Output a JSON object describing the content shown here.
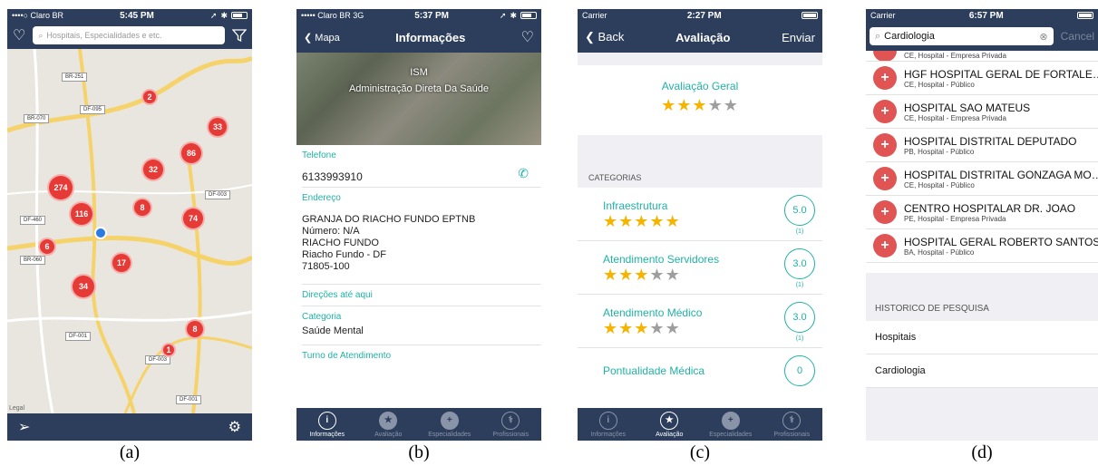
{
  "captions": [
    "(a)",
    "(b)",
    "(c)",
    "(d)"
  ],
  "colors": {
    "navy": "#2c3e5c",
    "teal": "#20b2a6",
    "red": "#e53a35",
    "star": "#f5b400"
  },
  "panel_a": {
    "status": {
      "carrier": "••••○ Claro BR",
      "time": "5:45 PM"
    },
    "search_placeholder": "Hospitais, Especialidades e etc.",
    "roads": [
      "BR-251",
      "BR-070",
      "DF-095",
      "DF-003",
      "DF-460",
      "BR-060",
      "DF-001",
      "DF-003",
      "DF-001"
    ],
    "clusters": [
      "2",
      "33",
      "86",
      "32",
      "274",
      "116",
      "8",
      "74",
      "6",
      "17",
      "34",
      "8",
      "1"
    ],
    "legal": "Legal"
  },
  "panel_b": {
    "status": {
      "carrier": "••••• Claro BR  3G",
      "time": "5:37 PM"
    },
    "back_label": "Mapa",
    "title": "Informações",
    "photo_title": "ISM",
    "photo_subtitle": "Administração Direta Da Saúde",
    "phone_label": "Telefone",
    "phone_value": "6133993910",
    "address_label": "Endereço",
    "address_lines": [
      "GRANJA DO RIACHO FUNDO EPTNB",
      "Número: N/A",
      "RIACHO FUNDO",
      "Riacho Fundo - DF",
      "71805-100"
    ],
    "directions_label": "Direções até aqui",
    "category_label": "Categoria",
    "category_value": "Saúde Mental",
    "hours_label": "Turno  de Atendimento",
    "tabs": [
      "Informações",
      "Avaliação",
      "Especialidades",
      "Profissionais"
    ]
  },
  "panel_c": {
    "status": {
      "carrier": "Carrier",
      "time": "2:27 PM"
    },
    "back_label": "Back",
    "title": "Avaliação",
    "send_label": "Enviar",
    "overall_label": "Avaliação Geral",
    "overall_stars": 3,
    "categories_header": "CATEGORIAS",
    "categories": [
      {
        "name": "Infraestrutura",
        "stars": 5,
        "score": "5.0",
        "count": "(1)"
      },
      {
        "name": "Atendimento Servidores",
        "stars": 3,
        "score": "3.0",
        "count": "(1)"
      },
      {
        "name": "Atendimento Médico",
        "stars": 3,
        "score": "3.0",
        "count": "(1)"
      },
      {
        "name": "Pontualidade Médica",
        "stars": 0,
        "score": "0",
        "count": ""
      }
    ],
    "tabs": [
      "Informações",
      "Avaliação",
      "Especialidades",
      "Profissionais"
    ]
  },
  "panel_d": {
    "status": {
      "carrier": "Carrier",
      "time": "6:57 PM"
    },
    "search_value": "Cardiologia",
    "cancel_label": "Cancel",
    "top_partial_sub": "CE, Hospital - Empresa Privada",
    "hospitals": [
      {
        "name": "HGF HOSPITAL GERAL DE FORTALEZA",
        "sub": "CE, Hospital - Público"
      },
      {
        "name": "HOSPITAL SAO MATEUS",
        "sub": "CE, Hospital - Empresa Privada"
      },
      {
        "name": "HOSPITAL DISTRITAL DEPUTADO",
        "sub": "PB, Hospital - Público"
      },
      {
        "name": "HOSPITAL DISTRITAL GONZAGA MOTA",
        "sub": "CE, Hospital - Público"
      },
      {
        "name": "CENTRO HOSPITALAR DR. JOAO",
        "sub": "PE, Hospital - Empresa Privada"
      },
      {
        "name": "HOSPITAL GERAL ROBERTO SANTOS",
        "sub": "BA, Hospital - Público"
      }
    ],
    "history_header": "HISTORICO DE PESQUISA",
    "history": [
      "Hospitais",
      "Cardiologia"
    ]
  }
}
